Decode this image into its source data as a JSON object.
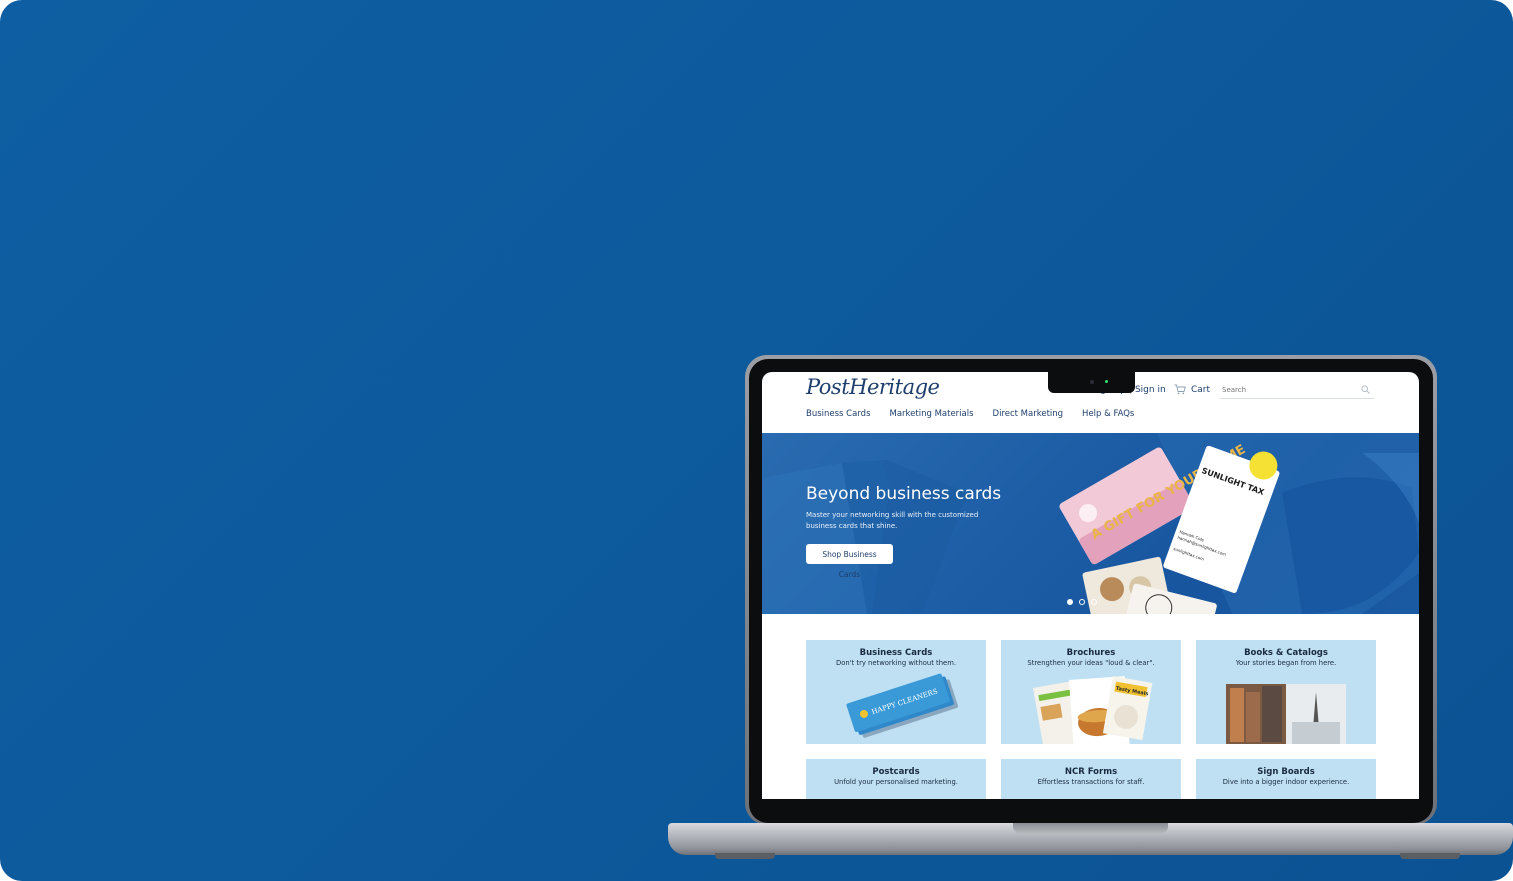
{
  "site": {
    "logo_text": "PostHeritage",
    "top_links": {
      "sign_up": "Sign up",
      "sign_in": "Sign in"
    },
    "cart_label": "Cart",
    "search_placeholder": "Search",
    "nav": [
      "Business Cards",
      "Marketing Materials",
      "Direct Marketing",
      "Help & FAQs"
    ]
  },
  "hero": {
    "title": "Beyond business cards",
    "subtitle": "Master your networking skill with the customized business cards that shine.",
    "button_label": "Shop Business Cards",
    "slides": 3,
    "active_slide": 1,
    "card_text": {
      "gift_card": "A GIFT FOR YOUR HOME",
      "sunlight": "SUNLIGHT TAX",
      "contact_name": "Hannah Cole",
      "contact_email": "hannah@sunlighttax.com",
      "contact_site": "sunlighttax.com"
    }
  },
  "categories": [
    {
      "title": "Business Cards",
      "subtitle": "Don't try networking without them.",
      "image_text": "HAPPY CLEANERS"
    },
    {
      "title": "Brochures",
      "subtitle": "Strengthen your ideas \"loud & clear\".",
      "image_text": "Tasty Meals"
    },
    {
      "title": "Books & Catalogs",
      "subtitle": "Your stories began from here.",
      "image_text": ""
    },
    {
      "title": "Postcards",
      "subtitle": "Unfold your personalised marketing.",
      "image_text": ""
    },
    {
      "title": "NCR Forms",
      "subtitle": "Effortless transactions for staff.",
      "image_text": ""
    },
    {
      "title": "Sign Boards",
      "subtitle": "Dive into a bigger indoor experience.",
      "image_text": ""
    }
  ],
  "colors": {
    "background": "#0e5ea3",
    "brand_navy": "#1e3f6d",
    "hero_blue": "#1d5ea6",
    "tile_bg": "#bfe0f2",
    "camera_led": "#2ee36b"
  }
}
